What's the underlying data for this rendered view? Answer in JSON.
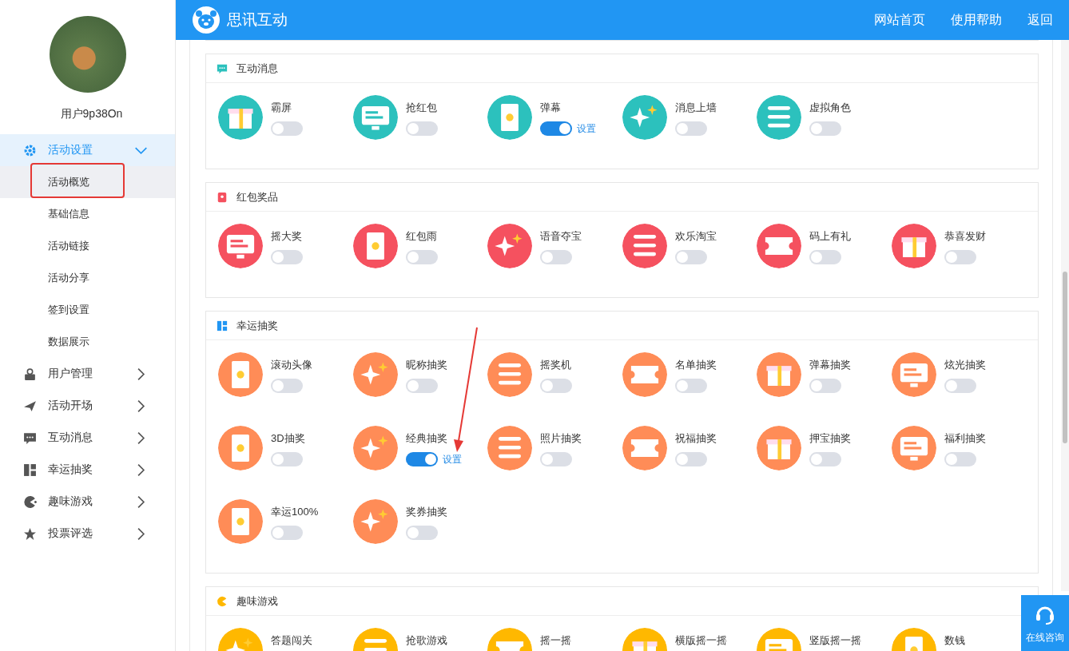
{
  "header": {
    "title": "思讯互动",
    "links": [
      "网站首页",
      "使用帮助",
      "返回"
    ]
  },
  "sidebar": {
    "username": "用户9p38On",
    "menu": [
      {
        "label": "活动设置",
        "expanded": true,
        "selected": true,
        "children": [
          {
            "label": "活动概览",
            "selected": true
          },
          {
            "label": "基础信息",
            "selected": false
          },
          {
            "label": "活动链接",
            "selected": false
          },
          {
            "label": "活动分享",
            "selected": false
          },
          {
            "label": "签到设置",
            "selected": false
          },
          {
            "label": "数据展示",
            "selected": false
          }
        ]
      },
      {
        "label": "用户管理",
        "expanded": false,
        "selected": false
      },
      {
        "label": "活动开场",
        "expanded": false,
        "selected": false
      },
      {
        "label": "互动消息",
        "expanded": false,
        "selected": false
      },
      {
        "label": "幸运抽奖",
        "expanded": false,
        "selected": false
      },
      {
        "label": "趣味游戏",
        "expanded": false,
        "selected": false
      },
      {
        "label": "投票评选",
        "expanded": false,
        "selected": false
      }
    ]
  },
  "sections": [
    {
      "title": "互动消息",
      "color": "#2cc1bd",
      "items": [
        {
          "label": "霸屏",
          "on": false
        },
        {
          "label": "抢红包",
          "on": false
        },
        {
          "label": "弹幕",
          "on": true,
          "settings_link": "设置"
        },
        {
          "label": "消息上墙",
          "on": false
        },
        {
          "label": "虚拟角色",
          "on": false
        }
      ]
    },
    {
      "title": "红包奖品",
      "color": "#f5515f",
      "items": [
        {
          "label": "摇大奖",
          "on": false
        },
        {
          "label": "红包雨",
          "on": false
        },
        {
          "label": "语音夺宝",
          "on": false
        },
        {
          "label": "欢乐淘宝",
          "on": false
        },
        {
          "label": "码上有礼",
          "on": false
        },
        {
          "label": "恭喜发财",
          "on": false
        }
      ]
    },
    {
      "title": "幸运抽奖",
      "color": "#ff8c57",
      "items": [
        {
          "label": "滚动头像",
          "on": false
        },
        {
          "label": "昵称抽奖",
          "on": false
        },
        {
          "label": "摇奖机",
          "on": false
        },
        {
          "label": "名单抽奖",
          "on": false
        },
        {
          "label": "弹幕抽奖",
          "on": false
        },
        {
          "label": "炫光抽奖",
          "on": false
        },
        {
          "label": "3D抽奖",
          "on": false
        },
        {
          "label": "经典抽奖",
          "on": true,
          "settings_link": "设置"
        },
        {
          "label": "照片抽奖",
          "on": false
        },
        {
          "label": "祝福抽奖",
          "on": false
        },
        {
          "label": "押宝抽奖",
          "on": false
        },
        {
          "label": "福利抽奖",
          "on": false
        },
        {
          "label": "幸运100%",
          "on": false
        },
        {
          "label": "奖券抽奖",
          "on": false
        }
      ]
    },
    {
      "title": "趣味游戏",
      "color": "#ffb800",
      "items": [
        {
          "label": "答题闯关"
        },
        {
          "label": "抢歌游戏"
        },
        {
          "label": "摇一摇"
        },
        {
          "label": "横版摇一摇"
        },
        {
          "label": "竖版摇一摇"
        },
        {
          "label": "数钱"
        }
      ]
    }
  ],
  "consult_button": {
    "label": "在线咨询"
  }
}
